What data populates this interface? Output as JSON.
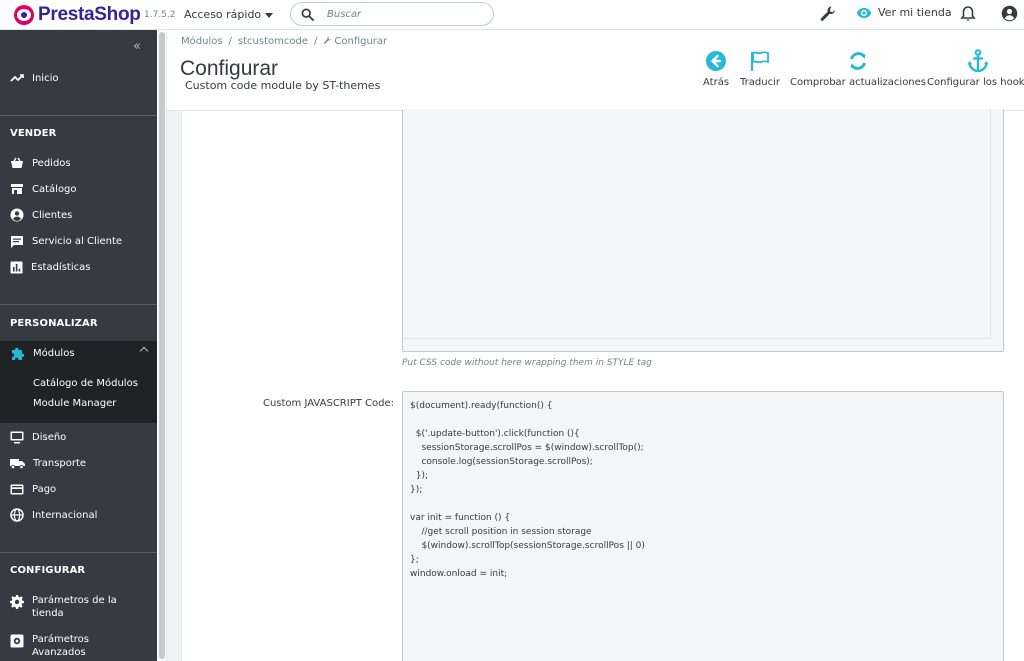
{
  "brand": {
    "name_part1": "Presta",
    "name_part2": "Shop",
    "version": "1.7.5.2"
  },
  "topbar": {
    "quick_access": "Acceso rápido",
    "search_placeholder": "Buscar",
    "view_store": "Ver mi tienda"
  },
  "sidebar": {
    "collapse_glyph": "«",
    "home": "Inicio",
    "sections": {
      "sell": "VENDER",
      "customize": "PERSONALIZAR",
      "configure": "CONFIGURAR"
    },
    "sell_items": [
      "Pedidos",
      "Catálogo",
      "Clientes",
      "Servicio al Cliente",
      "Estadísticas"
    ],
    "modules": "Módulos",
    "module_sub": [
      "Catálogo de Módulos",
      "Module Manager"
    ],
    "customize_items": [
      "Diseño",
      "Transporte",
      "Pago",
      "Internacional"
    ],
    "configure_items": [
      [
        "Parámetros de la",
        "tienda"
      ],
      [
        "Parámetros",
        "Avanzados"
      ]
    ]
  },
  "header": {
    "breadcrumb": [
      "Módulos",
      "stcustomcode",
      "Configurar"
    ],
    "title": "Configurar",
    "subtitle": "Custom code module by ST-themes",
    "toolbar": [
      "Atrás",
      "Traducir",
      "Comprobar actualizaciones",
      "Configurar los hooks"
    ]
  },
  "form": {
    "css_help": "Put CSS code without here wrapping them in STYLE tag",
    "js_label": "Custom JAVASCRIPT Code:",
    "js_code": [
      "$(document).ready(function() {",
      "",
      "  $('.update-button').click(function (){",
      "    sessionStorage.scrollPos = $(window).scrollTop();",
      "    console.log(sessionStorage.scrollPos);",
      "  });",
      "});",
      "",
      "var init = function () {",
      "    //get scroll position in session storage",
      "    $(window).scrollTop(sessionStorage.scrollPos || 0)",
      "};",
      "window.onload = init;"
    ]
  },
  "colors": {
    "accent": "#25b9d7",
    "sidebar_bg": "#363a41",
    "sidebar_active": "#202226",
    "brand_pink": "#df0067",
    "brand_navy": "#34219e"
  }
}
